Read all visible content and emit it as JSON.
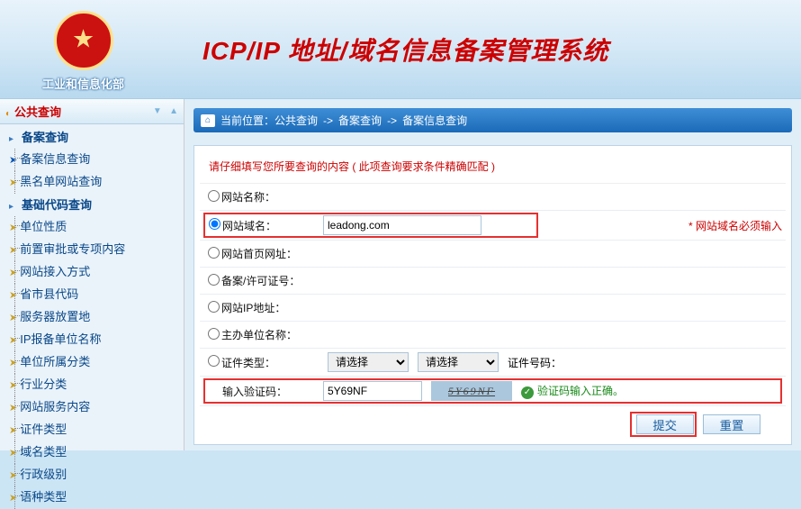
{
  "header": {
    "ministry": "工业和信息化部",
    "title": "ICP/IP 地址/域名信息备案管理系统"
  },
  "sidebar": {
    "panel_title": "公共查询",
    "group1_title": "备案查询",
    "group1_items": [
      "备案信息查询",
      "黑名单网站查询"
    ],
    "group2_title": "基础代码查询",
    "group2_items": [
      "单位性质",
      "前置审批或专项内容",
      "网站接入方式",
      "省市县代码",
      "服务器放置地",
      "IP报备单位名称",
      "单位所属分类",
      "行业分类",
      "网站服务内容",
      "证件类型",
      "域名类型",
      "行政级别",
      "语种类型"
    ]
  },
  "breadcrumb": {
    "label": "当前位置：",
    "c1": "公共查询",
    "c2": "备案查询",
    "c3": "备案信息查询",
    "sep": "->"
  },
  "form": {
    "instruction": "请仔细填写您所要查询的内容 ( 此项查询要求条件精确匹配 )",
    "r1_label": "网站名称：",
    "r2_label": "网站域名：",
    "r2_value": "leadong.com",
    "r2_hint": "* 网站域名必须输入",
    "r3_label": "网站首页网址：",
    "r4_label": "备案/许可证号：",
    "r5_label": "网站IP地址：",
    "r6_label": "主办单位名称：",
    "r7_label": "证件类型：",
    "r7_option": "请选择",
    "r7_cert_label": "证件号码：",
    "r8_label": "输入验证码：",
    "r8_value": "5Y69NF",
    "r8_captcha": "5Y69NF",
    "r8_ok": "验证码输入正确。",
    "submit": "提交",
    "reset": "重置"
  }
}
